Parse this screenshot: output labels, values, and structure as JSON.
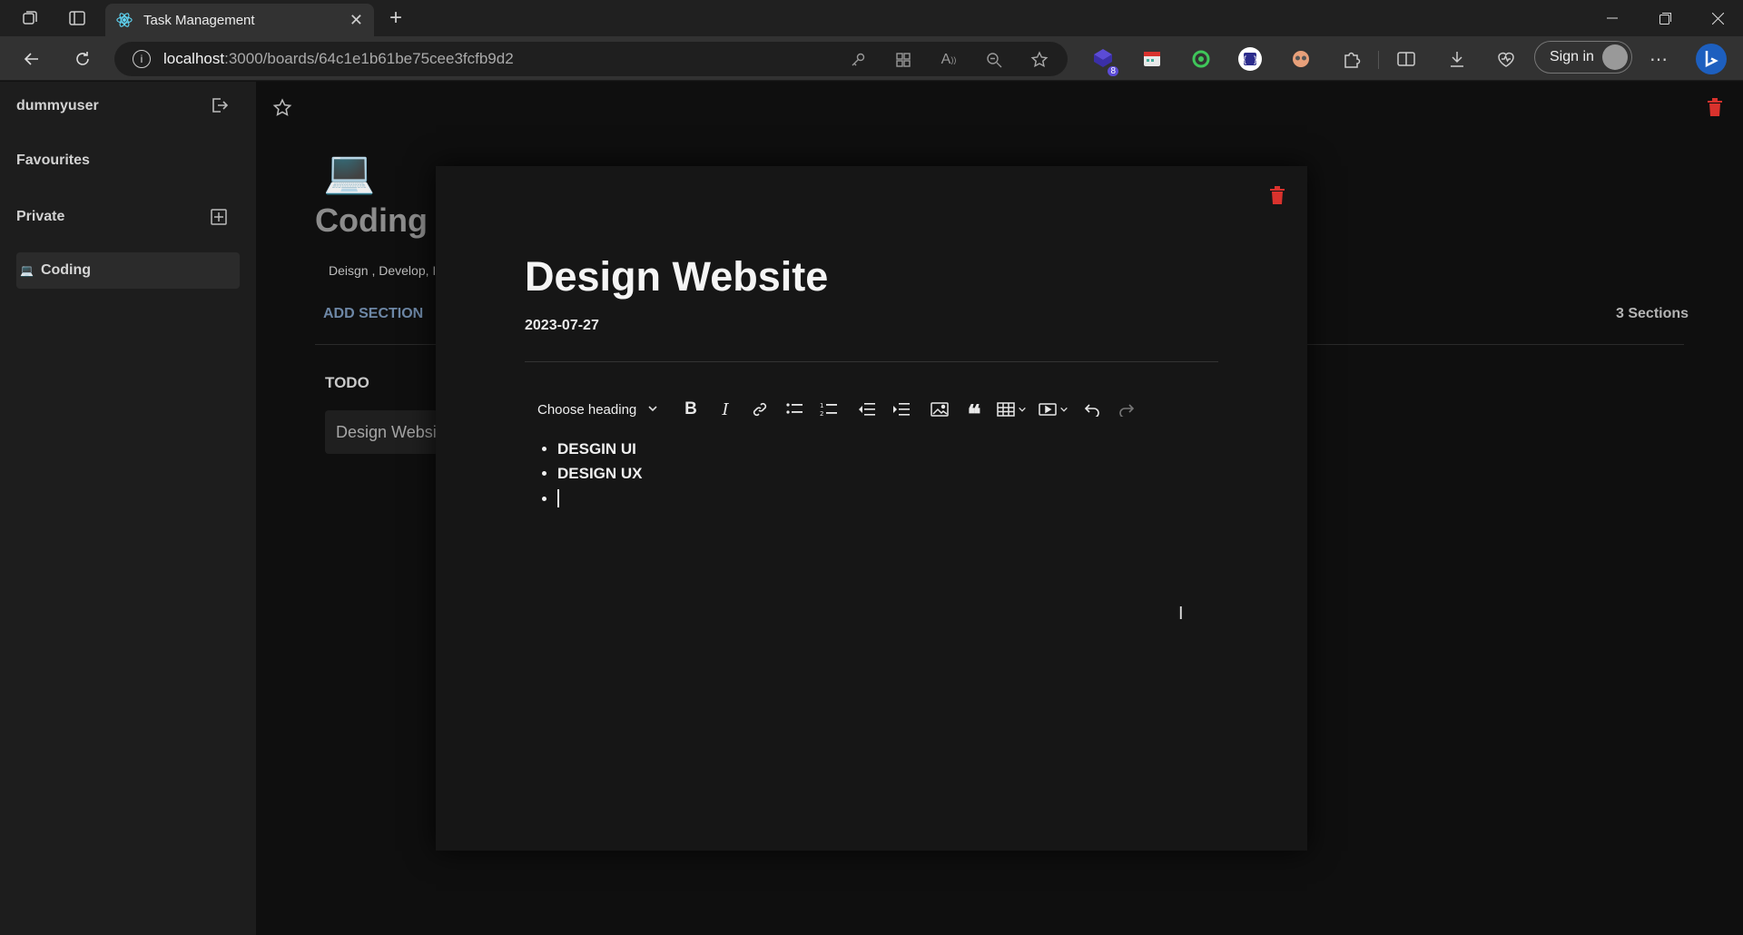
{
  "browser": {
    "tab_title": "Task Management",
    "url_host": "localhost",
    "url_rest": ":3000/boards/64c1e1b61be75cee3fcfb9d2",
    "signin_label": "Sign in",
    "extension_badge": "8"
  },
  "sidebar": {
    "username": "dummyuser",
    "favourites_label": "Favourites",
    "private_label": "Private",
    "boards": [
      {
        "icon": "laptop-icon",
        "label": "Coding"
      }
    ]
  },
  "board": {
    "emoji": "💻",
    "title": "Coding",
    "description": "Deisgn , Develop, I",
    "add_section_label": "ADD SECTION",
    "sections_count": "3 Sections",
    "sections": [
      {
        "title": "TODO",
        "cards": [
          "Design Websi"
        ]
      }
    ]
  },
  "task_modal": {
    "title": "Design Website",
    "date": "2023-07-27",
    "heading_select": "Choose heading",
    "content_items": [
      "DESGIN UI",
      "DESIGN UX",
      ""
    ]
  },
  "colors": {
    "danger": "#d9322d",
    "accent": "#6d87a6"
  }
}
